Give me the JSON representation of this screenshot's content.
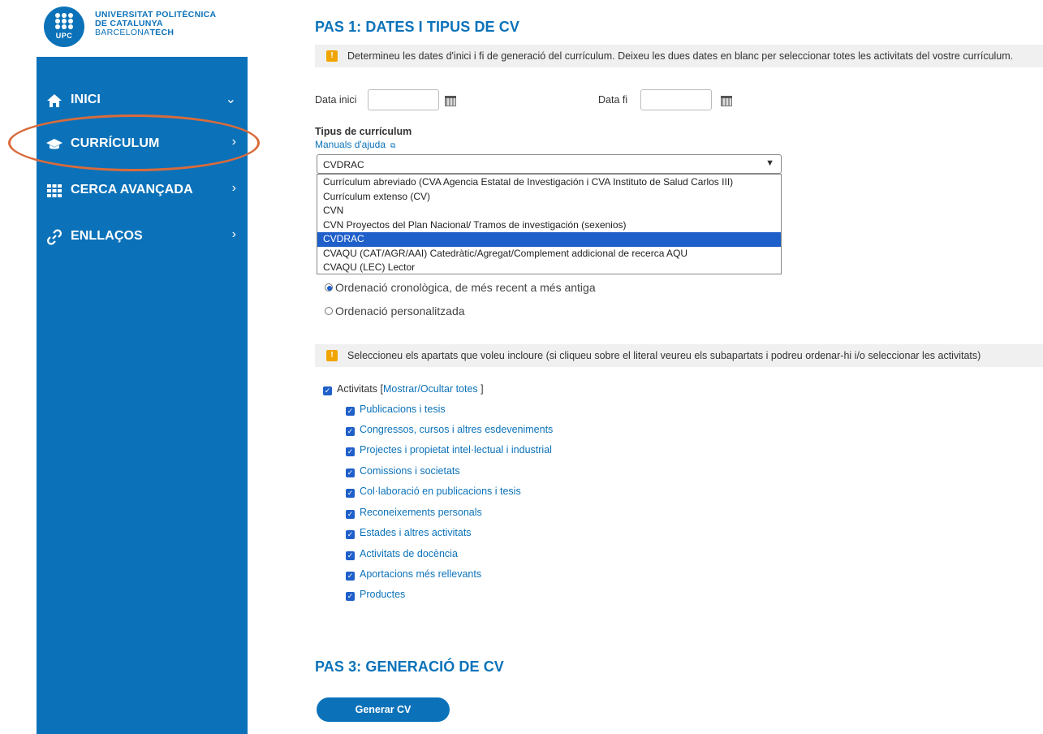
{
  "brand": {
    "logo_mark": "UPC",
    "line1": "UNIVERSITAT POLITÈCNICA",
    "line2": "DE CATALUNYA",
    "line3_light": "BARCELONA",
    "line3_bold": "TECH",
    "color": "#0b72b9"
  },
  "sidebar": {
    "items": [
      {
        "label": "INICI",
        "icon": "home-icon",
        "chevron": "⌄"
      },
      {
        "label": "CURRÍCULUM",
        "icon": "graduation-cap-icon",
        "chevron": "›"
      },
      {
        "label": "CERCA AVANÇADA",
        "icon": "grid-icon",
        "chevron": "›"
      },
      {
        "label": "ENLLAÇOS",
        "icon": "link-icon",
        "chevron": "›"
      }
    ],
    "highlight_color": "#d96b3b"
  },
  "step1": {
    "title": "PAS 1: DATES I TIPUS DE CV",
    "info": "Determineu les dates d'inici i fi de generació del currículum. Deixeu les dues dates en blanc per seleccionar totes les activitats del vostre currículum.",
    "start_label": "Data inici",
    "start_value": "",
    "end_label": "Data fi",
    "end_value": "",
    "type_label": "Tipus de currículum",
    "help_link": "Manuals d'ajuda",
    "selected": "CVDRAC",
    "options": [
      "Currículum abreviado (CVA Agencia Estatal de Investigación i CVA Instituto de Salud Carlos III)",
      "Currículum extenso (CV)",
      "CVN",
      "CVN Proyectos del Plan Nacional/ Tramos de investigación (sexenios)",
      "CVDRAC",
      "CVAQU (CAT/AGR/AAI) Catedràtic/Agregat/Complement addicional de recerca AQU",
      "CVAQU (LEC) Lector"
    ]
  },
  "ordering": {
    "chronological": "Ordenació cronològica, de més recent a més antiga",
    "custom": "Ordenació personalitzada"
  },
  "sections": {
    "info": "Seleccioneu els apartats que voleu incloure (si cliqueu sobre el literal veureu els subapartats i podreu ordenar-hi i/o seleccionar les activitats)",
    "root_label": "Activitats",
    "bracket_open": "[",
    "toggle_label": "Mostrar/Ocultar totes",
    "bracket_close": "]",
    "items": [
      "Publicacions i tesis",
      "Congressos, cursos i altres esdeveniments",
      "Projectes i propietat intel·lectual i industrial",
      "Comissions i societats",
      "Col·laboració en publicacions i tesis",
      "Reconeixements personals",
      "Estades i altres activitats",
      "Activitats de docència",
      "Aportacions més rellevants",
      "Productes"
    ]
  },
  "step3": {
    "title": "PAS 3: GENERACIÓ DE CV",
    "button": "Generar CV"
  }
}
